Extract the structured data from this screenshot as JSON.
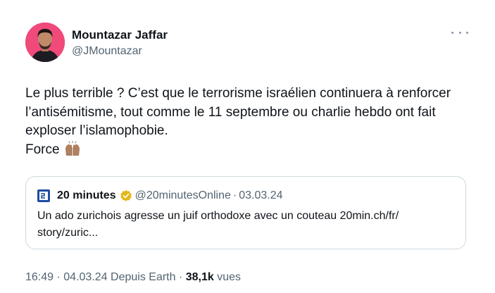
{
  "author": {
    "name": "Mountazar Jaffar",
    "handle": "@JMountazar",
    "avatar": "profile-photo"
  },
  "tweet": {
    "lines": [
      "Le plus terrible ? C’est que le terrorisme israélien continuera à renforcer",
      "l’antisémitisme, tout comme le 11 septembre ou charlie hebdo ont fait",
      "exploser l’islamophobie.",
      "Force"
    ],
    "emoji": "raising-hands-emoji"
  },
  "quoted": {
    "name": "20 minutes",
    "handle": "@20minutesOnline",
    "separator": "·",
    "date": "03.03.24",
    "lines": [
      "Un ado zurichois agresse un juif orthodoxe avec un couteau 20min.ch/fr/",
      "story/zuric..."
    ],
    "verified": "gold-verified-badge"
  },
  "meta": {
    "time": "16:49",
    "sep1": "·",
    "date": "04.03.24",
    "source": "Depuis Earth",
    "sep2": "·",
    "views_count": "38,1k",
    "views_label": "vues"
  },
  "colors": {
    "text": "#0f1419",
    "secondary": "#536471",
    "border": "#cfd9de",
    "avatar_bg": "#ef4a7a",
    "verified_gold": "#e2b719"
  }
}
